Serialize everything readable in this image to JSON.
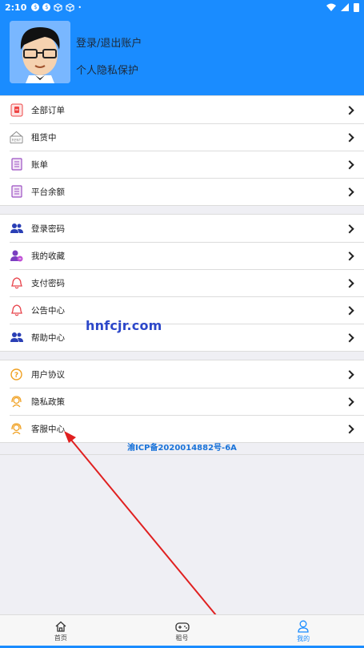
{
  "status_bar": {
    "time": "2:10"
  },
  "header": {
    "login_label": "登录/退出账户",
    "privacy_label": "个人隐私保护"
  },
  "group1": [
    {
      "label": "全部订单",
      "icon": "order-icon"
    },
    {
      "label": "租赁中",
      "icon": "rent-icon"
    },
    {
      "label": "账单",
      "icon": "bill-icon"
    },
    {
      "label": "平台余额",
      "icon": "balance-icon"
    }
  ],
  "group2": [
    {
      "label": "登录密码",
      "icon": "users-icon"
    },
    {
      "label": "我的收藏",
      "icon": "user-favorite-icon"
    },
    {
      "label": "支付密码",
      "icon": "bell-icon"
    },
    {
      "label": "公告中心",
      "icon": "bell-icon"
    },
    {
      "label": "帮助中心",
      "icon": "users-icon"
    }
  ],
  "group3": [
    {
      "label": "用户协议",
      "icon": "question-icon"
    },
    {
      "label": "隐私政策",
      "icon": "headset-icon"
    },
    {
      "label": "客服中心",
      "icon": "headset-icon"
    }
  ],
  "icp": "渝ICP备2020014882号-6A",
  "watermark": "hnfcjr.com",
  "tabbar": [
    {
      "label": "首页",
      "icon": "home-icon",
      "active": false
    },
    {
      "label": "租号",
      "icon": "gamepad-icon",
      "active": false
    },
    {
      "label": "我的",
      "icon": "person-icon",
      "active": true
    }
  ],
  "colors": {
    "brand": "#1a8cff",
    "arrow": "#e02020"
  }
}
